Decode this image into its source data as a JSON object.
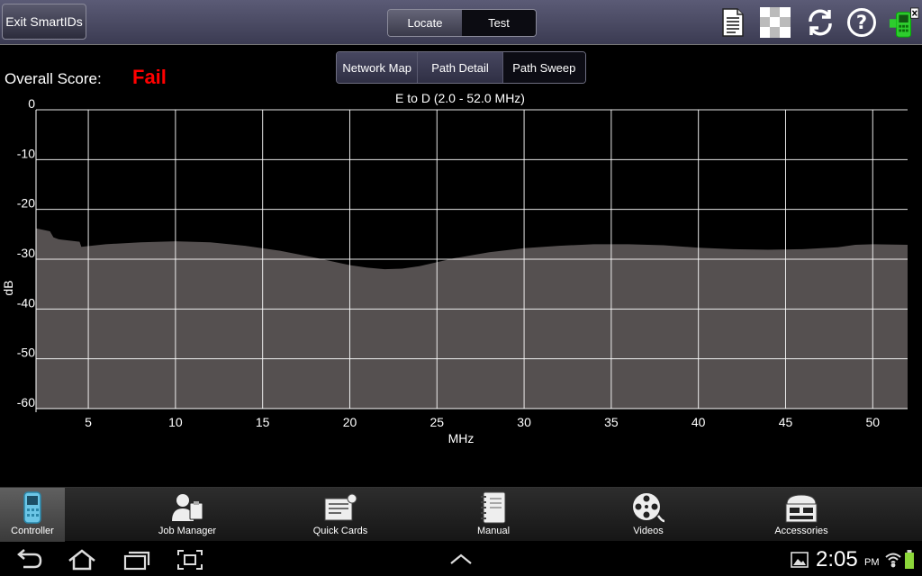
{
  "header": {
    "exit_label": "Exit SmartIDs",
    "mode_tabs": [
      {
        "label": "Locate",
        "selected": false
      },
      {
        "label": "Test",
        "selected": true
      }
    ],
    "icons": [
      "report-icon",
      "checkerboard-icon",
      "refresh-icon",
      "help-icon",
      "meter-status-icon"
    ]
  },
  "score": {
    "label": "Overall Score:",
    "value": "Fail",
    "value_color": "#ff0000"
  },
  "view_tabs": [
    {
      "label": "Network Map",
      "selected": false
    },
    {
      "label": "Path Detail",
      "selected": false
    },
    {
      "label": "Path Sweep",
      "selected": true
    }
  ],
  "chart_data": {
    "type": "area",
    "title": "E to D (2.0 - 52.0 MHz)",
    "xlabel": "MHz",
    "ylabel": "dB",
    "xlim": [
      2,
      52
    ],
    "ylim": [
      -60,
      0
    ],
    "xticks": [
      5,
      10,
      15,
      20,
      25,
      30,
      35,
      40,
      45,
      50
    ],
    "yticks": [
      0,
      -10,
      -20,
      -30,
      -40,
      -50,
      -60
    ],
    "grid": true,
    "fill_color": "#555050",
    "series": [
      {
        "x": [
          2.0,
          2.8,
          3.0,
          3.3,
          3.5,
          4.5,
          4.6,
          6.0,
          8.0,
          10.0,
          12.0,
          14.0,
          16.0,
          18.0,
          20.0,
          21.0,
          22.0,
          23.0,
          24.0,
          26.0,
          28.0,
          30.0,
          32.0,
          34.0,
          36.0,
          38.0,
          40.0,
          42.0,
          44.0,
          46.0,
          48.0,
          49.0,
          50.0,
          52.0
        ],
        "y": [
          -23.8,
          -24.4,
          -25.6,
          -26.0,
          -26.1,
          -26.5,
          -27.5,
          -27.0,
          -26.6,
          -26.4,
          -26.6,
          -27.3,
          -28.3,
          -29.7,
          -31.2,
          -31.7,
          -32.0,
          -31.9,
          -31.4,
          -29.8,
          -28.6,
          -27.8,
          -27.3,
          -27.0,
          -27.0,
          -27.2,
          -27.7,
          -28.0,
          -28.1,
          -28.0,
          -27.6,
          -27.1,
          -27.0,
          -27.1
        ]
      }
    ]
  },
  "bottom_nav": [
    {
      "label": "Controller",
      "active": true
    },
    {
      "label": "Job Manager",
      "active": false
    },
    {
      "label": "Quick Cards",
      "active": false
    },
    {
      "label": "Manual",
      "active": false
    },
    {
      "label": "Videos",
      "active": false
    },
    {
      "label": "Accessories",
      "active": false
    }
  ],
  "system_bar": {
    "time": "2:05",
    "ampm": "PM"
  }
}
